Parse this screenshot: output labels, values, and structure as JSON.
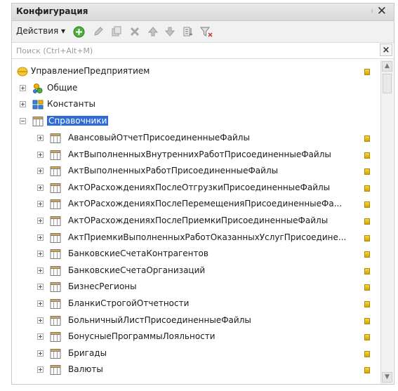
{
  "window": {
    "title": "Конфигурация",
    "pin_glyph": "ₗ",
    "close_glyph": "✕"
  },
  "toolbar": {
    "actions_label": "Действия ▾",
    "icons": [
      "add-icon",
      "edit-icon",
      "copy-icon",
      "delete-icon",
      "move-up-icon",
      "move-down-icon",
      "sort-icon",
      "filter-icon"
    ]
  },
  "search": {
    "placeholder": "Поиск (Ctrl+Alt+M)",
    "value": "",
    "clear_glyph": "×"
  },
  "tree": {
    "root": {
      "label": "УправлениеПредприятием",
      "icon": "config-root-icon"
    },
    "sections": [
      {
        "label": "Общие",
        "icon": "common-icon",
        "expanded": false
      },
      {
        "label": "Константы",
        "icon": "constants-icon",
        "expanded": false
      },
      {
        "label": "Справочники",
        "icon": "catalog-icon",
        "expanded": true,
        "selected": true
      }
    ],
    "catalogs": [
      "АвансовыйОтчетПрисоединенныеФайлы",
      "АктВыполненныхВнутреннихРаботПрисоединенныеФайлы",
      "АктВыполненныхРаботПрисоединенныеФайлы",
      "АктОРасхожденияхПослеОтгрузкиПрисоединенныеФайлы",
      "АктОРасхожденияхПослеПеремещенияПрисоединенныеФа...",
      "АктОРасхожденияхПослеПриемкиПрисоединенныеФайлы",
      "АктПриемкиВыполненныхРаботОказанныхУслугПрисоедине...",
      "БанковскиеСчетаКонтрагентов",
      "БанковскиеСчетаОрганизаций",
      "БизнесРегионы",
      "БланкиСтрогойОтчетности",
      "БольничныйЛистПрисоединенныеФайлы",
      "БонусныеПрограммыЛояльности",
      "Бригады",
      "Валюты"
    ]
  },
  "colors": {
    "selection": "#2f6bd7",
    "lock": "#e8bf1c",
    "add_green": "#4caf3a"
  }
}
